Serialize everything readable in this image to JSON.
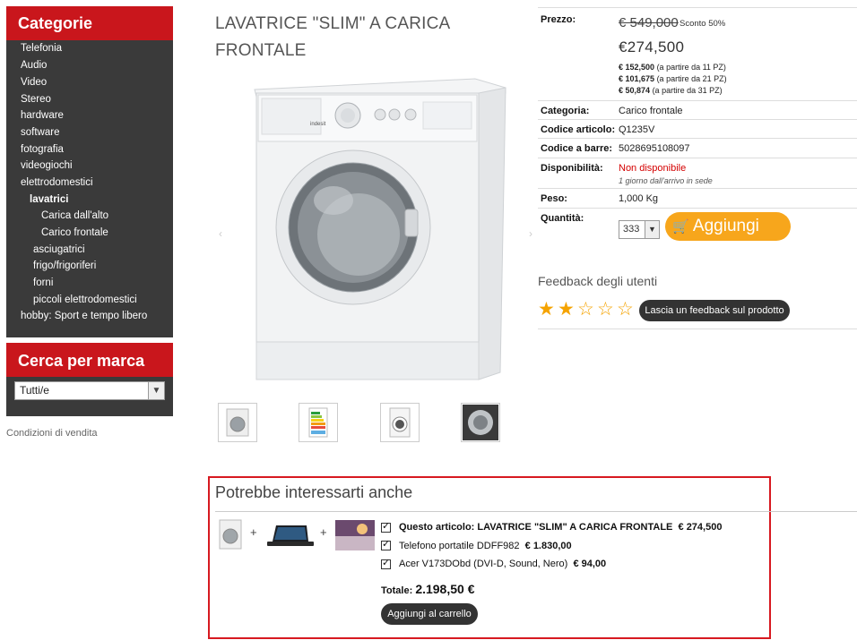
{
  "sidebar": {
    "categories_title": "Categorie",
    "categories": [
      {
        "label": "Telefonia",
        "level": 0
      },
      {
        "label": "Audio",
        "level": 0
      },
      {
        "label": "Video",
        "level": 0
      },
      {
        "label": "Stereo",
        "level": 0
      },
      {
        "label": "hardware",
        "level": 0
      },
      {
        "label": "software",
        "level": 0
      },
      {
        "label": "fotografia",
        "level": 0
      },
      {
        "label": "videogiochi",
        "level": 0
      },
      {
        "label": "elettrodomestici",
        "level": 0
      },
      {
        "label": "lavatrici",
        "level": 1,
        "active": true
      },
      {
        "label": "Carica dall'alto",
        "level": 2
      },
      {
        "label": "Carico frontale",
        "level": 2
      },
      {
        "label": "asciugatrici",
        "level": 1
      },
      {
        "label": "frigo/frigoriferi",
        "level": 1
      },
      {
        "label": "forni",
        "level": 1
      },
      {
        "label": "piccoli elettrodomestici",
        "level": 1
      },
      {
        "label": "hobby: Sport e tempo libero",
        "level": 0
      }
    ],
    "brand_title": "Cerca per marca",
    "brand_select_value": "Tutti/e",
    "terms_link": "Condizioni di vendita"
  },
  "product": {
    "title": "LAVATRICE \"SLIM\" A CARICA FRONTALE",
    "price_label": "Prezzo:",
    "old_price": "€ 549,000",
    "discount": "Sconto 50%",
    "price": "€274,500",
    "tiers": [
      {
        "price": "€ 152,500",
        "note": "(a partire da 11 PZ)"
      },
      {
        "price": "€ 101,675",
        "note": "(a partire da 21 PZ)"
      },
      {
        "price": "€ 50,874",
        "note": "(a partire da 31 PZ)"
      }
    ],
    "category_label": "Categoria:",
    "category": "Carico frontale",
    "code_label": "Codice articolo:",
    "code": "Q1235V",
    "barcode_label": "Codice a barre:",
    "barcode": "5028695108097",
    "availability_label": "Disponibilità:",
    "availability": "Non disponibile",
    "availability_note": "1 giorno dall'arrivo in sede",
    "weight_label": "Peso:",
    "weight": "1,000 Kg",
    "quantity_label": "Quantità:",
    "quantity": "333",
    "add_button": "Aggiungi",
    "feedback_title": "Feedback degli utenti",
    "rating": 2,
    "rating_max": 5,
    "feedback_button": "Lascia un feedback sul prodotto",
    "carousel_prev": "‹",
    "carousel_next": "›"
  },
  "related": {
    "title": "Potrebbe interessarti anche",
    "items": [
      {
        "label": "Questo articolo: LAVATRICE \"SLIM\" A CARICA FRONTALE",
        "price": "€ 274,500",
        "bold": true
      },
      {
        "label": "Telefono portatile DDFF982",
        "price": "€ 1.830,00",
        "bold": false
      },
      {
        "label": "Acer V173DObd (DVI-D, Sound, Nero)",
        "price": "€ 94,00",
        "bold": false
      }
    ],
    "plus": "+",
    "total_label": "Totale:",
    "total_value": "2.198,50 €",
    "cart_button": "Aggiungi al carrello"
  },
  "colors": {
    "accent_red": "#c9161c",
    "sidebar_bg": "#3a3a3a",
    "add_button": "#f7a61c",
    "star": "#f5a300",
    "unavailable": "#d40000"
  }
}
